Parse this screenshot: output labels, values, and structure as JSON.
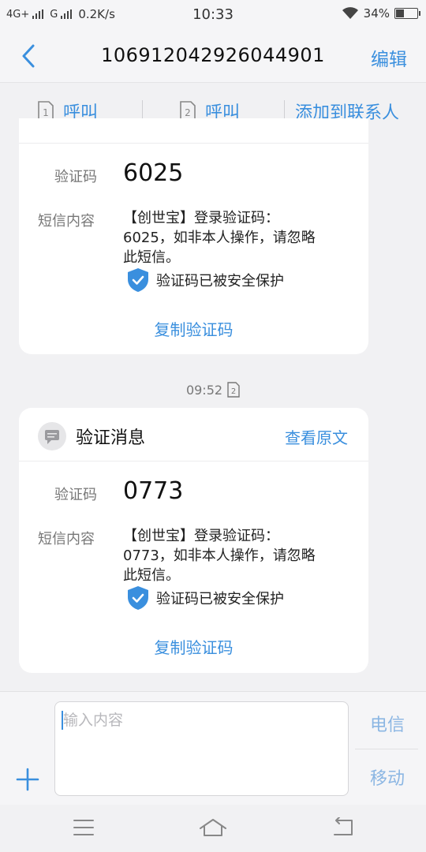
{
  "status_bar": {
    "network1": "4G+",
    "network2": "G",
    "speed": "0.2K/s",
    "time": "10:33",
    "battery": "34%",
    "battery_level": 0.34
  },
  "header": {
    "title": "106912042926044901",
    "edit_label": "编辑",
    "back_icon": "chevron-left-icon"
  },
  "actions": {
    "call1": {
      "sim": "1",
      "label": "呼叫"
    },
    "call2": {
      "sim": "2",
      "label": "呼叫"
    },
    "add_contact": "添加到联系人"
  },
  "messages": [
    {
      "code_label": "验证码",
      "code": "6025",
      "content_label": "短信内容",
      "content_lines": [
        "【创世宝】登录验证码：",
        "6025，如非本人操作，请忽略",
        "此短信。"
      ],
      "protect_text": "验证码已被安全保护",
      "copy_label": "复制验证码"
    },
    {
      "time": "09:52",
      "sim": "2",
      "title": "验证消息",
      "view_original": "查看原文",
      "code_label": "验证码",
      "code": "0773",
      "content_label": "短信内容",
      "content_lines": [
        "【创世宝】登录验证码：",
        "0773，如非本人操作，请忽略",
        "此短信。"
      ],
      "protect_text": "验证码已被安全保护",
      "copy_label": "复制验证码"
    }
  ],
  "composer": {
    "placeholder": "输入内容",
    "send_sim1": "电信",
    "send_sim2": "移动"
  },
  "colors": {
    "accent": "#3a8fde",
    "shield": "#3a8fde"
  }
}
